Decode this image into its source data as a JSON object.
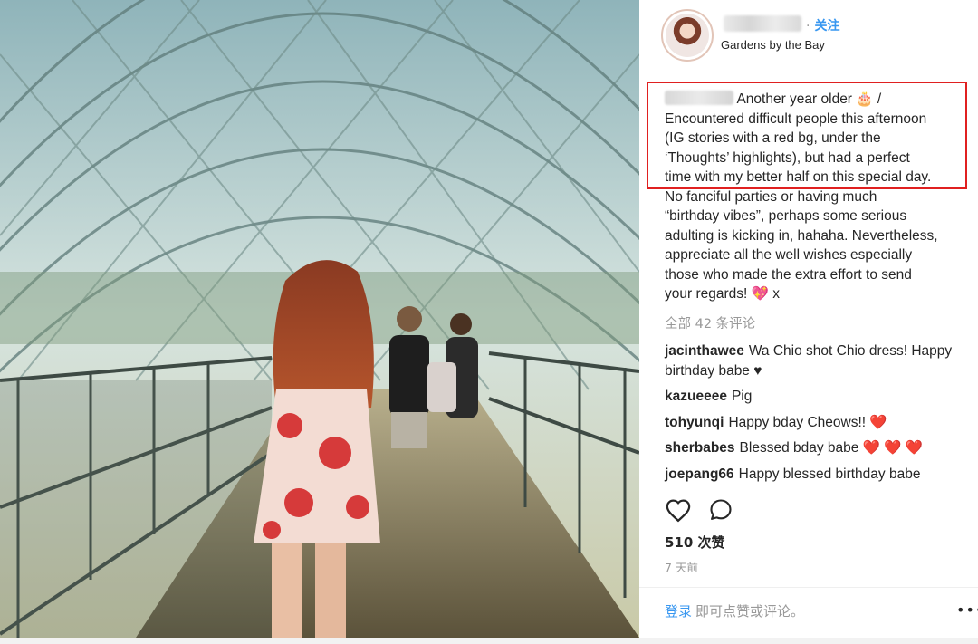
{
  "post": {
    "follow_label": "关注",
    "location": "Gardens by the Bay",
    "caption": {
      "lines": [
        "Another year older 🎂 /",
        "Encountered difficult people this afternoon",
        "(IG stories with a red bg, under the",
        "‘Thoughts’ highlights), but had a perfect",
        "time with my better half on this special day.",
        "No fanciful parties or having much",
        "“birthday vibes”, perhaps some serious",
        "adulting is kicking in, hahaha. Nevertheless,",
        "appreciate all the well wishes especially",
        "those who made the extra effort to send",
        "your regards! 💖 x"
      ]
    },
    "all_comments_label": "全部 42 条评论",
    "comments": [
      {
        "user": "jacinthawee",
        "text": "Wa Chio shot Chio dress! Happy birthday babe ♥"
      },
      {
        "user": "kazueeee",
        "text": "Pig"
      },
      {
        "user": "tohyunqi",
        "text": "Happy bday Cheows!! ❤️"
      },
      {
        "user": "sherbabes",
        "text": "Blessed bday babe ❤️ ❤️ ❤️"
      },
      {
        "user": "joepang66",
        "text": "Happy blessed birthday babe"
      }
    ],
    "likes_label": "510 次赞",
    "time_label": "7 天前",
    "login_link": "登录",
    "login_prompt": "即可点赞或评论。",
    "more_label": "•••",
    "icons": {
      "like": "heart-icon",
      "comment": "comment-icon"
    },
    "colors": {
      "link": "#3897f0",
      "highlight": "#e02020",
      "muted": "#999999"
    }
  }
}
